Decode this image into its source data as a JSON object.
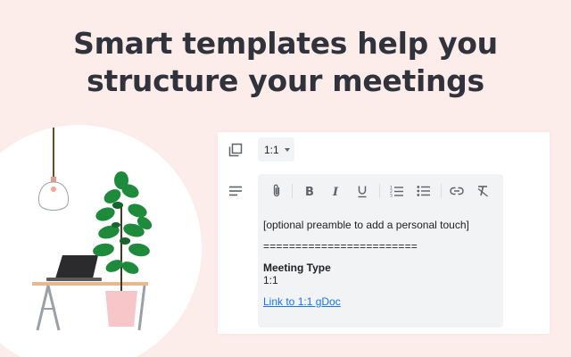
{
  "headline": {
    "line1": "Smart templates help you",
    "line2": "structure your meetings"
  },
  "panel": {
    "icons": {
      "template_icon": "copy-icon",
      "notes_icon": "notes-icon"
    },
    "template_select": {
      "value": "1:1"
    },
    "toolbar": {
      "items": [
        "attach-icon",
        "bold-icon",
        "italic-icon",
        "underline-icon",
        "numbered-list-icon",
        "bulleted-list-icon",
        "link-icon",
        "clear-formatting-icon"
      ]
    },
    "editor": {
      "preamble": "[optional preamble to add a personal touch]",
      "divider": "========================",
      "section_heading": "Meeting Type",
      "section_value": "1:1",
      "doc_link": "Link to 1:1 gDoc"
    }
  },
  "colors": {
    "background": "#fcecea",
    "headline": "#30323c",
    "editor_bg": "#f1f3f4",
    "link": "#1a73e8",
    "plant": "#1e8a3c",
    "pot": "#f7c6c9"
  }
}
